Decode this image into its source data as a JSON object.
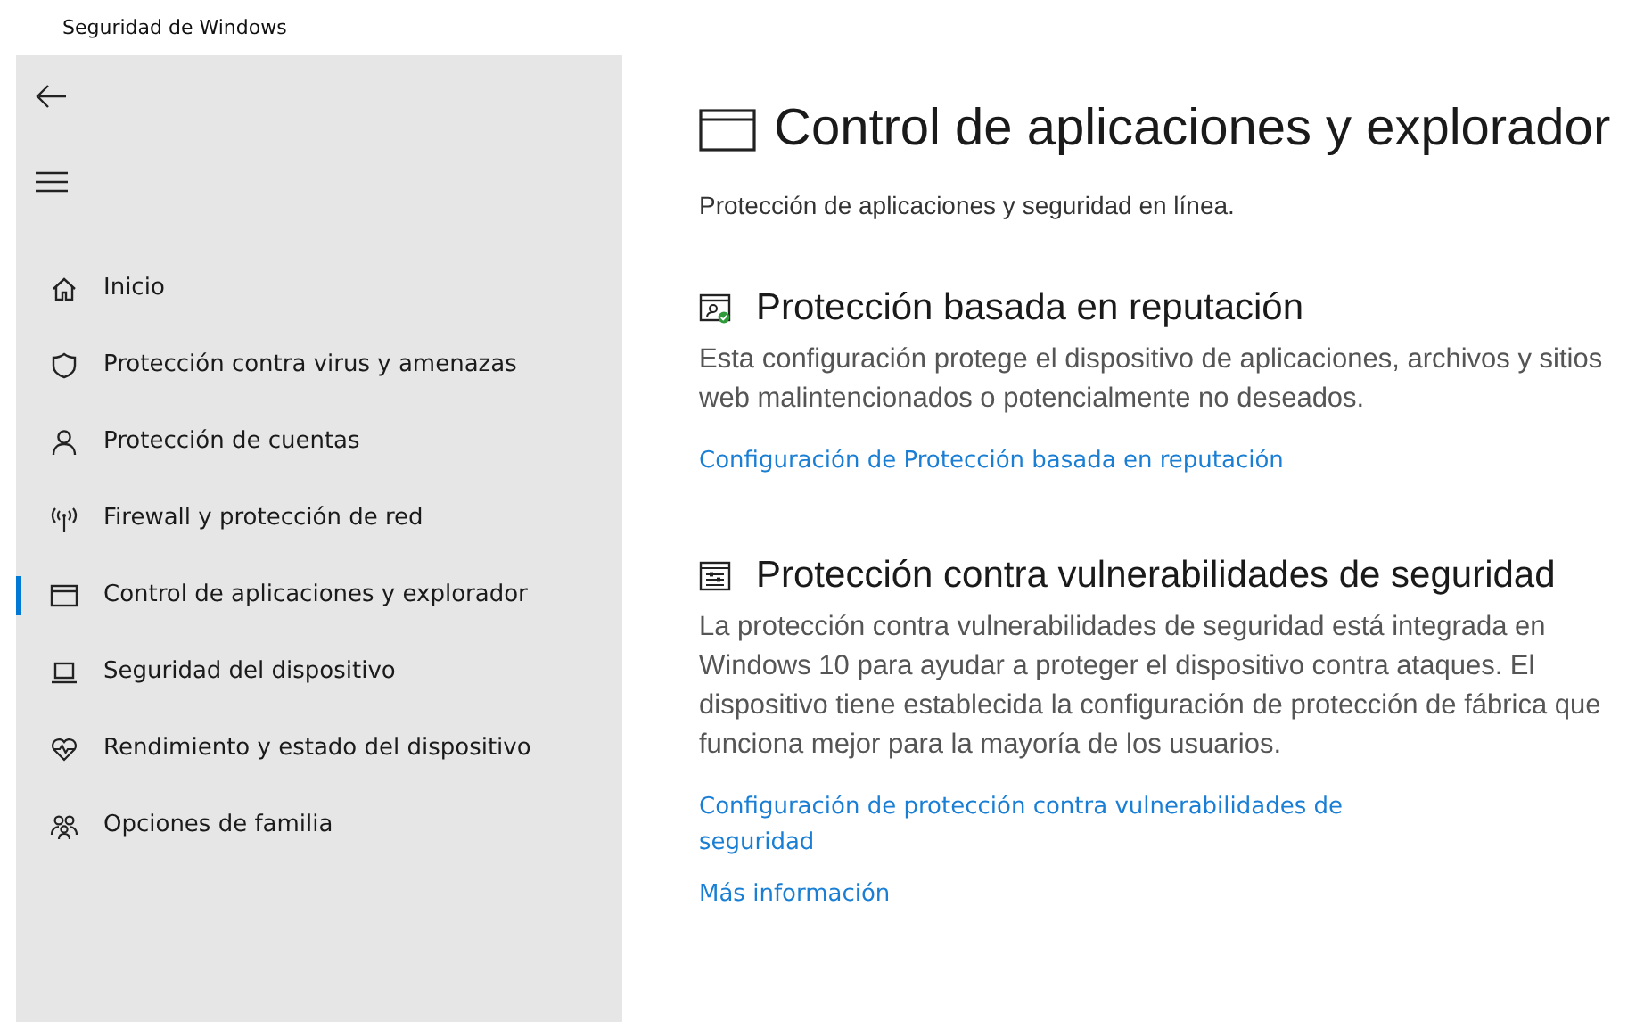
{
  "window": {
    "title": "Seguridad de Windows"
  },
  "sidebar": {
    "items": [
      {
        "label": "Inicio",
        "selected": false
      },
      {
        "label": "Protección contra virus y amenazas",
        "selected": false
      },
      {
        "label": "Protección de cuentas",
        "selected": false
      },
      {
        "label": "Firewall y protección de red",
        "selected": false
      },
      {
        "label": "Control de aplicaciones y explorador",
        "selected": true
      },
      {
        "label": "Seguridad del dispositivo",
        "selected": false
      },
      {
        "label": "Rendimiento y estado del dispositivo",
        "selected": false
      },
      {
        "label": "Opciones de familia",
        "selected": false
      }
    ]
  },
  "page": {
    "title": "Control de aplicaciones y explorador",
    "subtitle": "Protección de aplicaciones y seguridad en línea.",
    "sections": [
      {
        "heading": "Protección basada en reputación",
        "body": "Esta configuración protege el dispositivo de aplicaciones, archivos y sitios web malintencionados o potencialmente no deseados.",
        "links": [
          "Configuración de Protección basada en reputación"
        ]
      },
      {
        "heading": "Protección contra vulnerabilidades de seguridad",
        "body": "La protección contra vulnerabilidades de seguridad está integrada en Windows 10 para ayudar a proteger el dispositivo contra ataques. El dispositivo tiene establecida la configuración de protección de fábrica que funciona mejor para la mayoría de los usuarios.",
        "links": [
          "Configuración de protección contra vulnerabilidades de seguridad",
          "Más información"
        ]
      }
    ]
  }
}
